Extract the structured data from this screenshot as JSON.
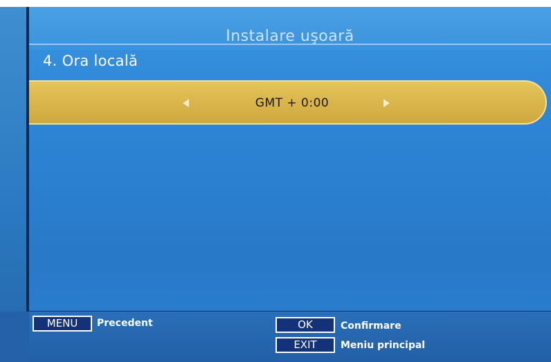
{
  "header": {
    "title": "Instalare uşoară"
  },
  "section": {
    "title": "4. Ora locală"
  },
  "selector": {
    "value": "GMT + 0:00",
    "left_icon": "arrow-left-icon",
    "right_icon": "arrow-right-icon"
  },
  "footer": {
    "menu_key": "MENU",
    "menu_label": "Precedent",
    "ok_key": "OK",
    "ok_label": "Confirmare",
    "exit_key": "EXIT",
    "exit_label": "Meniu principal"
  },
  "colors": {
    "background_blue": "#2e86d6",
    "selector_gold": "#d8b44a",
    "text_white": "#ffffff"
  }
}
